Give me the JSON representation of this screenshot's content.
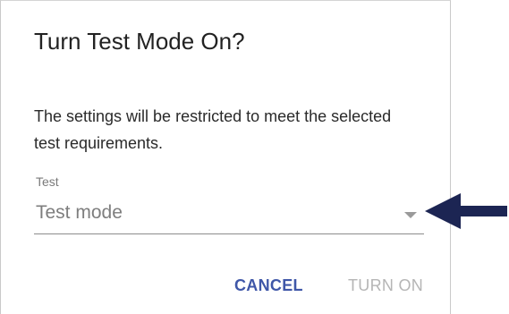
{
  "dialog": {
    "title": "Turn Test Mode On?",
    "body": "The settings will be restricted to meet the selected test requirements.",
    "test_select": {
      "label": "Test",
      "value": "Test mode"
    },
    "actions": {
      "cancel_label": "CANCEL",
      "turn_on_label": "TURN ON"
    }
  },
  "annotation": {
    "icon": "arrow-left-icon",
    "color": "#1c2553"
  },
  "colors": {
    "accent": "#3f57a8",
    "disabled": "#b5b5b5"
  }
}
